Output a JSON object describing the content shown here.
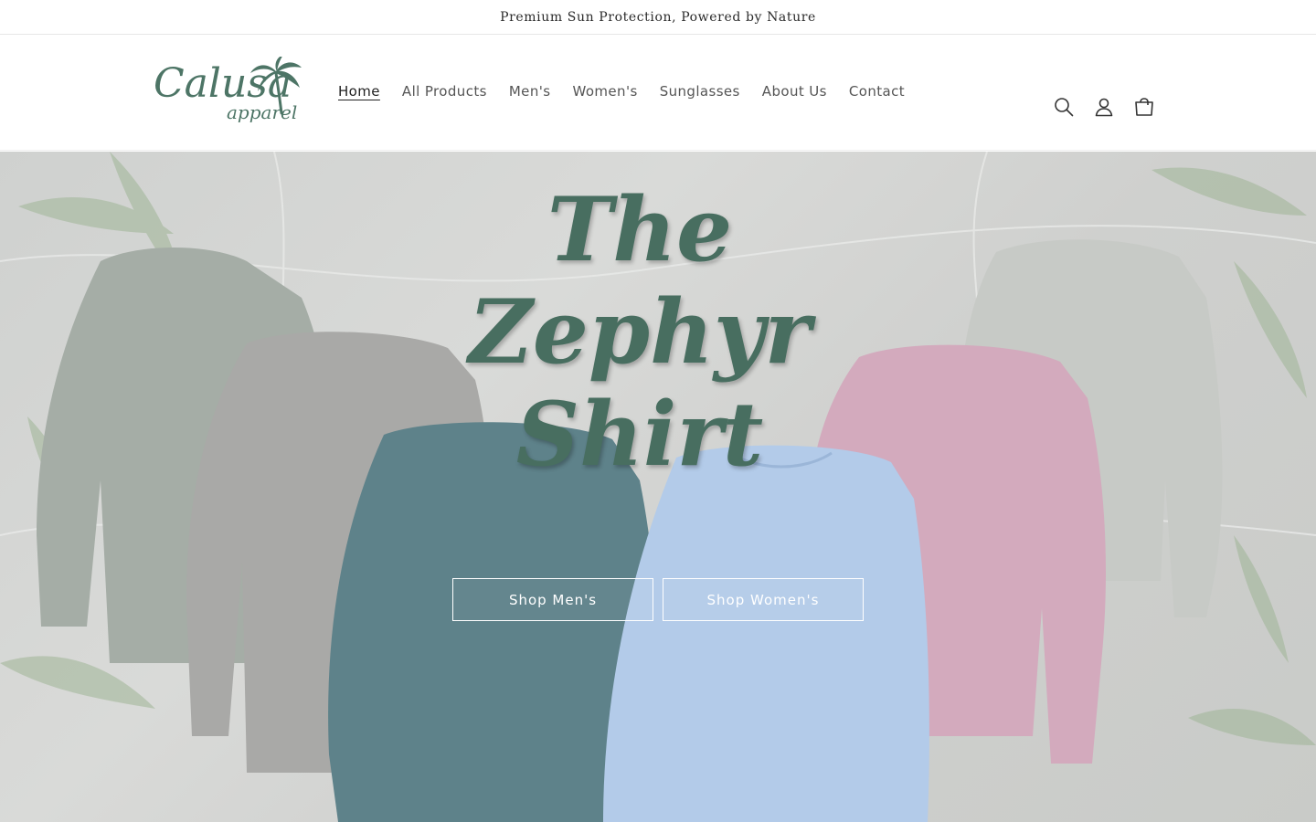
{
  "announcement": "Premium Sun Protection, Powered by Nature",
  "logo": {
    "main_text": "Calusa",
    "sub_text": "apparel",
    "color": "#4d7566"
  },
  "nav": {
    "items": [
      {
        "label": "Home",
        "active": true
      },
      {
        "label": "All Products"
      },
      {
        "label": "Men's"
      },
      {
        "label": "Women's"
      },
      {
        "label": "Sunglasses"
      },
      {
        "label": "About Us"
      },
      {
        "label": "Contact"
      }
    ]
  },
  "header_icons": [
    "search-icon",
    "account-icon",
    "cart-icon"
  ],
  "hero": {
    "title_line1": "The Zephyr",
    "title_line2": "Shirt",
    "title_color": "#486e60",
    "buttons": {
      "shop_men": "Shop Men's",
      "shop_women": "Shop Women's"
    },
    "shirt_colors": [
      "#a5ada6",
      "#a9a9a7",
      "#5e828a",
      "#b3cbe9",
      "#d3aabd",
      "#c7cac6"
    ]
  }
}
